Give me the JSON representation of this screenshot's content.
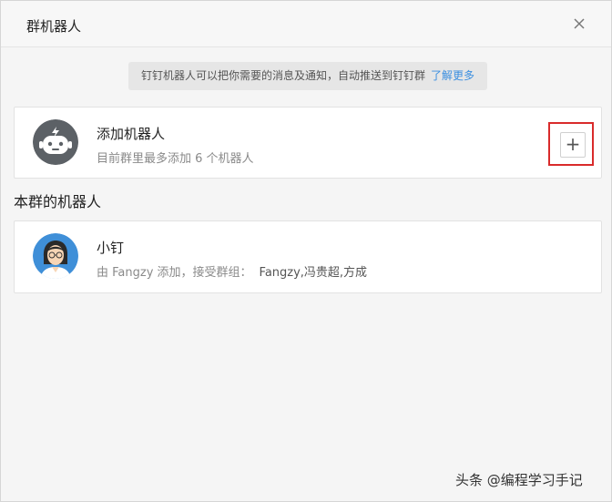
{
  "dialog": {
    "title": "群机器人",
    "close_icon": "close-icon"
  },
  "notice": {
    "text": "钉钉机器人可以把你需要的消息及通知，自动推送到钉钉群",
    "link": "了解更多"
  },
  "add_robot": {
    "title": "添加机器人",
    "subtitle": "目前群里最多添加 6 个机器人",
    "icon": "robot-icon",
    "button_icon": "plus-icon",
    "button_symbol": "+"
  },
  "section": {
    "title": "本群的机器人"
  },
  "robots": [
    {
      "name": "小钉",
      "added_by": "由 Fangzy 添加，接受群组：",
      "groups": "Fangzy,冯贵超,方成",
      "avatar": "person-avatar"
    }
  ],
  "watermark": "头条 @编程学习手记",
  "colors": {
    "link": "#3b8fe0",
    "highlight_border": "#d92b2b",
    "robot_icon_bg": "#5c6166",
    "avatar_bg": "#3f8fd8"
  }
}
